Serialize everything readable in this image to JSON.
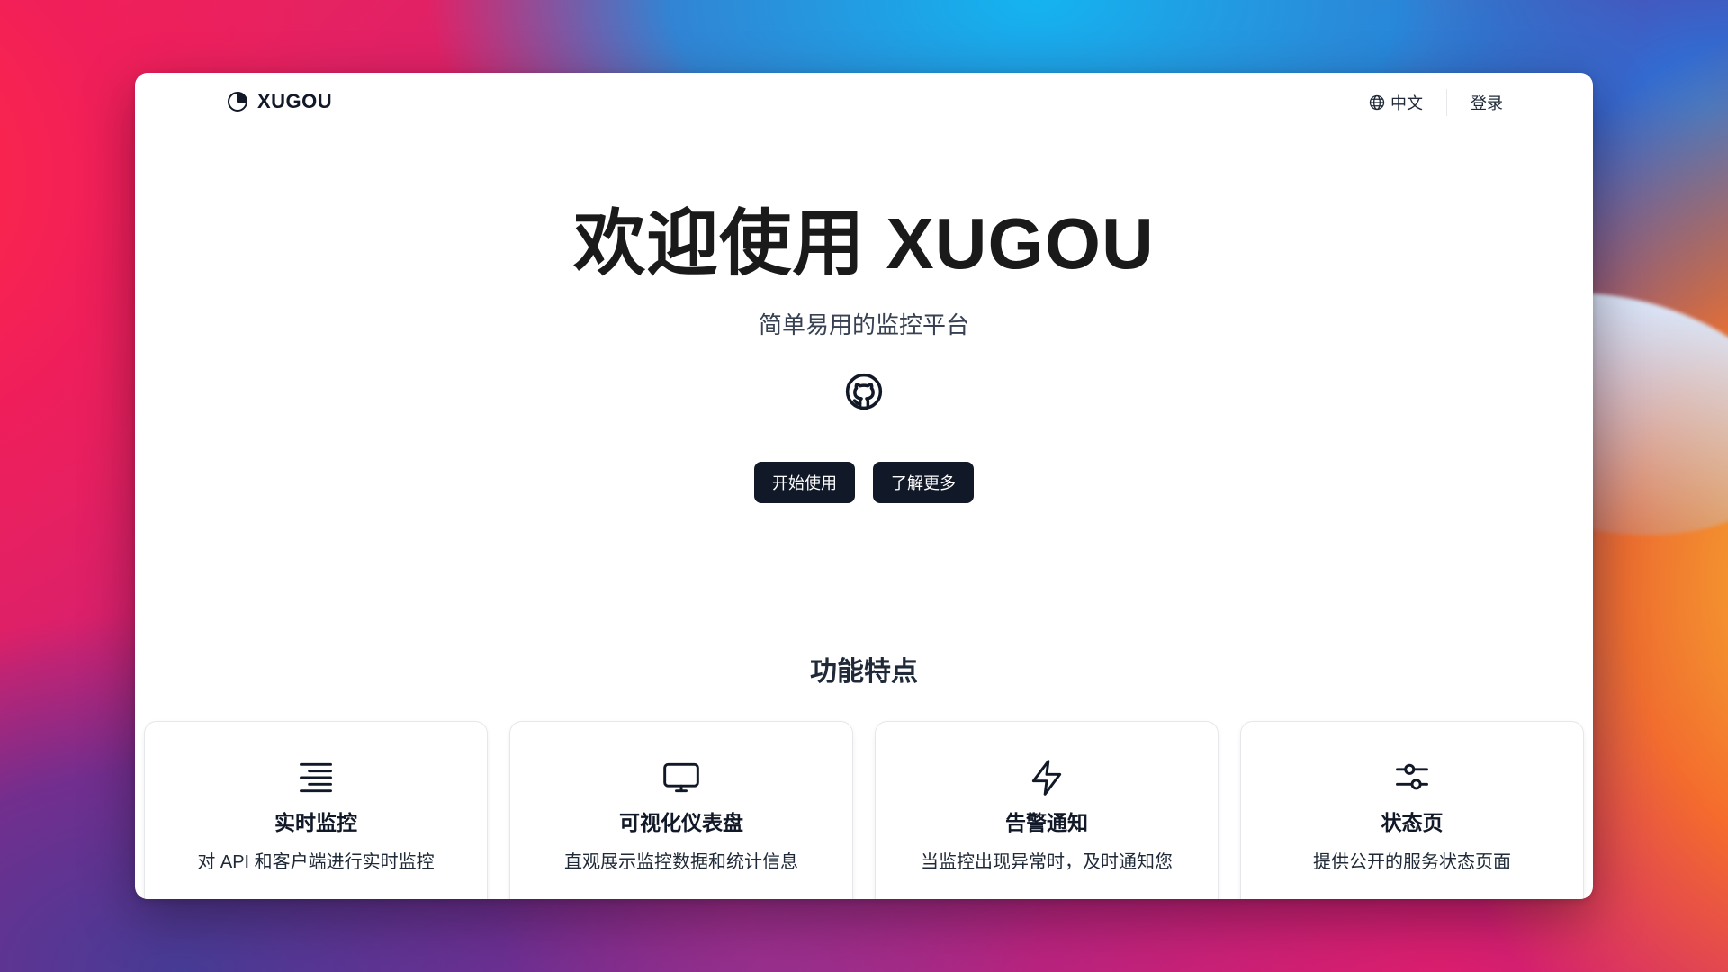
{
  "app": {
    "brand_name": "XUGOU",
    "accent_color": "#111827"
  },
  "navbar": {
    "language_label": "中文",
    "login_label": "登录"
  },
  "hero": {
    "title": "欢迎使用 XUGOU",
    "subtitle": "简单易用的监控平台",
    "github_icon": "github-icon",
    "primary_button": "开始使用",
    "secondary_button": "了解更多"
  },
  "features": {
    "section_title": "功能特点",
    "items": [
      {
        "icon": "list-icon",
        "title": "实时监控",
        "description": "对 API 和客户端进行实时监控"
      },
      {
        "icon": "monitor-icon",
        "title": "可视化仪表盘",
        "description": "直观展示监控数据和统计信息"
      },
      {
        "icon": "lightning-icon",
        "title": "告警通知",
        "description": "当监控出现异常时，及时通知您"
      },
      {
        "icon": "sliders-icon",
        "title": "状态页",
        "description": "提供公开的服务状态页面"
      }
    ]
  }
}
